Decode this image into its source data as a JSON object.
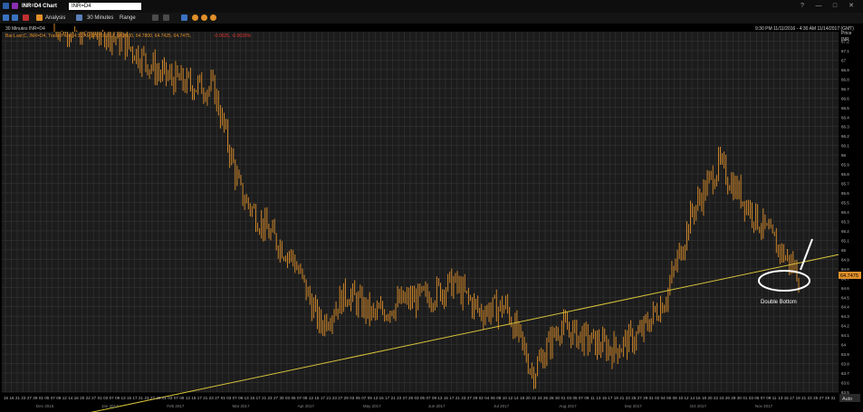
{
  "window": {
    "title": "INR=D4 Chart",
    "symbol_input": "INR=D4",
    "controls": [
      "?",
      "—",
      "□",
      "✕"
    ]
  },
  "toolbar": {
    "items": [
      "Analysis",
      "30 Minutes",
      "Range"
    ]
  },
  "legend": {
    "header": "30 Minutes INR=D4",
    "series_line": "Bar;Last;C, INR=D4, Trade Price, 4:30 AM 10/26/2017, 64.7500, 64.7800, 64.7425, 64.7475,",
    "series_change": "-0.0025, -0.0039%",
    "date_range": "9:30 PM 11/11/2016 - 4:30 AM 11/14/2017 (GMT)"
  },
  "price_axis": {
    "title": "Price",
    "unit": "INR",
    "current_price": "64.7475",
    "tick_labels": [
      "67.2",
      "67.1",
      "67",
      "66.9",
      "66.8",
      "66.7",
      "66.6",
      "66.5",
      "66.4",
      "66.3",
      "66.2",
      "66.1",
      "66",
      "65.9",
      "65.8",
      "65.7",
      "65.6",
      "65.5",
      "65.4",
      "65.3",
      "65.2",
      "65.1",
      "65",
      "64.9",
      "64.8",
      "64.7",
      "64.6",
      "64.5",
      "64.4",
      "64.3",
      "64.2",
      "64.1",
      "64",
      "63.9",
      "63.8",
      "63.7",
      "63.6",
      "63.5"
    ]
  },
  "time_axis": {
    "tick_labels": [
      "15",
      "16",
      "21",
      "23",
      "27",
      "29",
      "01",
      "05",
      "07",
      "09",
      "12",
      "14",
      "16",
      "20",
      "22",
      "27",
      "01",
      "03",
      "07",
      "09",
      "13",
      "15",
      "17",
      "21",
      "23",
      "27",
      "29",
      "01",
      "03",
      "07",
      "09",
      "13",
      "15",
      "17",
      "21",
      "23",
      "27",
      "01",
      "03",
      "07",
      "09",
      "13",
      "15",
      "17",
      "21",
      "23",
      "27",
      "30",
      "03",
      "05",
      "07",
      "09",
      "13",
      "15",
      "17",
      "21",
      "23",
      "27",
      "29",
      "03",
      "05",
      "07",
      "09",
      "13",
      "15",
      "17",
      "21",
      "23",
      "27",
      "29",
      "03",
      "05",
      "07",
      "09",
      "13",
      "15",
      "17",
      "21",
      "23",
      "27",
      "29",
      "02",
      "04",
      "06",
      "08",
      "10",
      "12",
      "14",
      "18",
      "20",
      "22",
      "24",
      "26",
      "28",
      "30",
      "01",
      "03",
      "05",
      "07",
      "09",
      "11",
      "13",
      "15",
      "17",
      "19",
      "21",
      "23",
      "25",
      "27",
      "29",
      "31",
      "02",
      "04",
      "06",
      "08",
      "10",
      "12",
      "14",
      "16",
      "18",
      "20",
      "22",
      "24",
      "26",
      "28",
      "30",
      "01",
      "03",
      "05",
      "07",
      "09",
      "11",
      "13",
      "15",
      "17",
      "19",
      "21",
      "23",
      "25",
      "27",
      "29",
      "31"
    ],
    "month_labels": [
      "Dec 2016",
      "Jan 2017",
      "Feb 2017",
      "Mar 2017",
      "Apr 2017",
      "May 2017",
      "Jun 2017",
      "Jul 2017",
      "Aug 2017",
      "Sep 2017",
      "Oct 2017",
      "Nov 2017"
    ],
    "zoom_button": "Auto"
  },
  "annotation": {
    "text": "Double Bottom"
  },
  "colors": {
    "background": "#1c1c1c",
    "grid": "#3a3a3a",
    "price_bar": "#e0902a",
    "trendline": "#d6c23a",
    "axis_text": "#bdbdbd",
    "current_price_tag": "#e0902a",
    "annotation": "#ffffff",
    "change_text": "#e03030"
  },
  "icons": [
    "app-menu-icon",
    "link-icon",
    "chart-type-icon",
    "analysis-icon",
    "interval-icon",
    "range-icon",
    "table-icon",
    "settings-icon",
    "save-icon",
    "refresh-icon",
    "draw-icon",
    "zoom-icon",
    "print-icon",
    "help-icon",
    "minimize-icon",
    "maximize-icon",
    "close-icon"
  ],
  "chart_data": {
    "type": "line",
    "title": "30 Minutes INR=D4",
    "xlabel": "",
    "ylabel": "Price INR",
    "ylim": [
      63.5,
      67.3
    ],
    "x": [
      "Nov 2016",
      "Dec 2016",
      "Jan 2017",
      "Feb 2017",
      "Feb 2017",
      "Mar 2017",
      "Mar 2017",
      "Mar 2017",
      "Apr 2017",
      "Apr 2017",
      "Apr 2017",
      "May 2017",
      "May 2017",
      "May 2017",
      "Jun 2017",
      "Jun 2017",
      "Jul 2017",
      "Jul 2017",
      "Jul 2017",
      "Aug 2017",
      "Aug 2017",
      "Aug 2017",
      "Sep 2017",
      "Sep 2017",
      "Sep 2017",
      "Oct 2017",
      "Oct 2017",
      "Oct 2017",
      "Nov 2017"
    ],
    "series": [
      {
        "values": [
          67.4,
          67.3,
          67.3,
          67.1,
          66.85,
          66.75,
          66.7,
          65.6,
          65.2,
          64.9,
          64.2,
          64.55,
          64.3,
          64.45,
          64.5,
          64.65,
          64.35,
          64.4,
          63.7,
          64.2,
          64.05,
          63.95,
          64.1,
          64.5,
          65.4,
          65.9,
          65.5,
          65.1,
          64.75
        ]
      }
    ],
    "trendline": {
      "from": [
        63.3
      ],
      "to": [
        64.95
      ]
    },
    "grid": true,
    "legend": "top-left"
  }
}
